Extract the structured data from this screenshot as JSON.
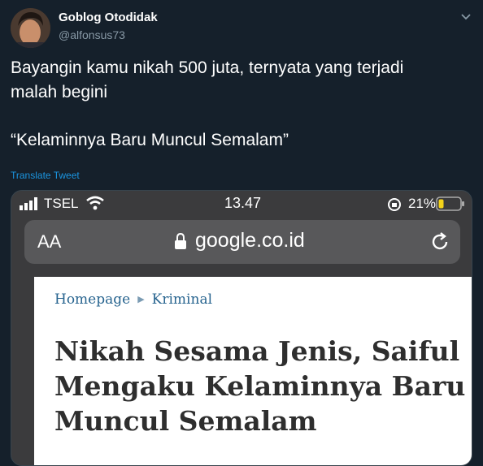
{
  "author": {
    "display_name": "Goblog Otodidak",
    "handle": "@alfonsus73"
  },
  "tweet": {
    "text_lines": [
      "Bayangin kamu nikah 500 juta, ternyata yang terjadi",
      "malah begini",
      "“Kelaminnya Baru Muncul Semalam”"
    ],
    "translate_label": "Translate Tweet"
  },
  "screenshot": {
    "status_bar": {
      "carrier": "TSEL",
      "time": "13.47",
      "battery": "21%"
    },
    "url_bar": {
      "text_size_label": "AA",
      "url": "google.co.id"
    },
    "article": {
      "breadcrumb": [
        "Homepage",
        "Kriminal"
      ],
      "headline_lines": [
        "Nikah Sesama Jenis, Saiful",
        "Mengaku Kelaminnya Baru",
        "Muncul Semalam"
      ]
    }
  },
  "icons": [
    "avatar",
    "chevron-down-icon",
    "signal-icon",
    "wifi-icon",
    "rotation-lock-icon",
    "battery-icon",
    "lock-icon",
    "reload-icon",
    "breadcrumb-arrow-icon"
  ],
  "colors": {
    "background": "#15202b",
    "link": "#1b95e0",
    "secondary_text": "#8899a6",
    "breadcrumb": "#27648f",
    "battery_low": "#f4d31a"
  }
}
